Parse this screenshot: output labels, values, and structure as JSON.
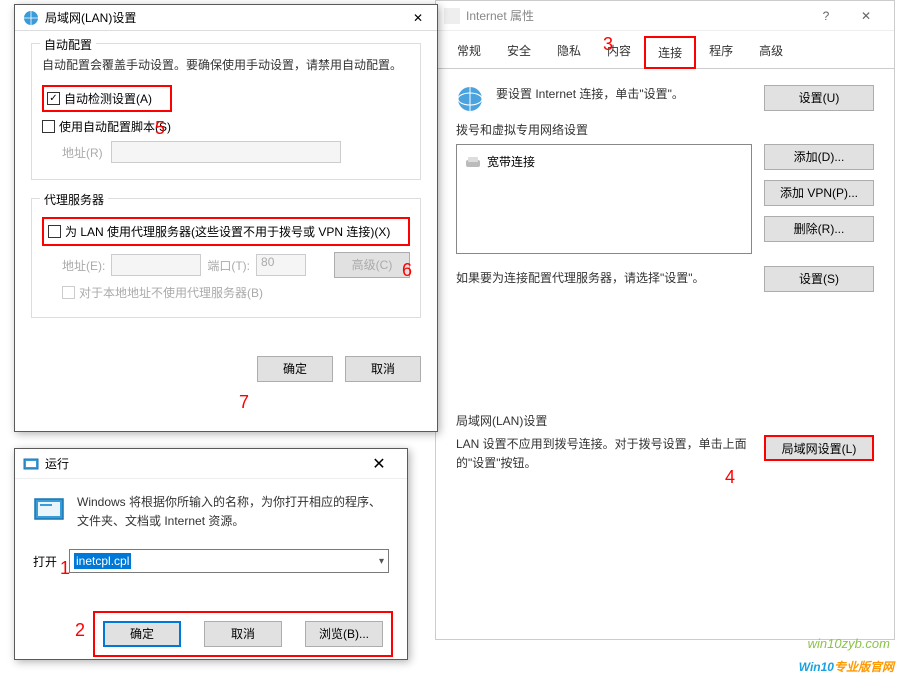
{
  "inet": {
    "title": "Internet 属性",
    "tabs": [
      "常规",
      "安全",
      "隐私",
      "内容",
      "连接",
      "程序",
      "高级"
    ],
    "active_tab_index": 4,
    "conn_desc": "要设置 Internet 连接，单击\"设置\"。",
    "btn_setup": "设置(U)",
    "dial_group": "拨号和虚拟专用网络设置",
    "dial_item": "宽带连接",
    "btn_add": "添加(D)...",
    "btn_addvpn": "添加 VPN(P)...",
    "btn_remove": "删除(R)...",
    "proxy_note": "如果要为连接配置代理服务器，请选择\"设置\"。",
    "btn_settings": "设置(S)",
    "lan_group": "局域网(LAN)设置",
    "lan_desc": "LAN 设置不应用到拨号连接。对于拨号设置，单击上面的\"设置\"按钮。",
    "btn_lan": "局域网设置(L)"
  },
  "lan": {
    "title": "局域网(LAN)设置",
    "auto_group": "自动配置",
    "auto_desc": "自动配置会覆盖手动设置。要确保使用手动设置，请禁用自动配置。",
    "chk_autodetect": "自动检测设置(A)",
    "chk_autoscript": "使用自动配置脚本(S)",
    "addr_label": "地址(R)",
    "proxy_group": "代理服务器",
    "chk_proxy": "为 LAN 使用代理服务器(这些设置不用于拨号或 VPN 连接)(X)",
    "addr_e": "地址(E):",
    "port_t": "端口(T):",
    "port_val": "80",
    "btn_adv": "高级(C)",
    "chk_bypass": "对于本地地址不使用代理服务器(B)",
    "btn_ok": "确定",
    "btn_cancel": "取消"
  },
  "run": {
    "title": "运行",
    "desc": "Windows 将根据你所输入的名称，为你打开相应的程序、文件夹、文档或 Internet 资源。",
    "open_label": "打开",
    "value": "inetcpl.cpl",
    "btn_ok": "确定",
    "btn_cancel": "取消",
    "btn_browse": "浏览(B)..."
  },
  "annotations": {
    "n1": "1",
    "n2": "2",
    "n3": "3",
    "n4": "4",
    "n5": "5",
    "n6": "6",
    "n7": "7"
  },
  "watermark": {
    "sub": "win10zyb.com",
    "main1": "Win10",
    "main2": "专业版官网"
  }
}
